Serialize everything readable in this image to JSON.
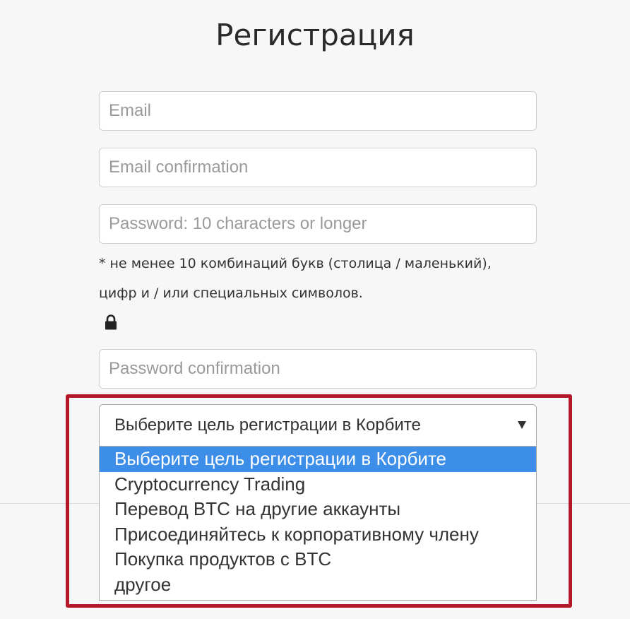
{
  "form": {
    "title": "Регистрация",
    "email": {
      "placeholder": "Email"
    },
    "email_confirmation": {
      "placeholder": "Email confirmation"
    },
    "password": {
      "placeholder": "Password: 10 characters or longer"
    },
    "password_hint": {
      "line1": "* не менее 10 комбинаций букв (столица / маленький),",
      "line2": "цифр и / или специальных символов."
    },
    "lock_icon": "lock-icon",
    "password_confirmation": {
      "placeholder": "Password confirmation"
    }
  },
  "purpose_select": {
    "selected_value": "Выберите цель регистрации в Корбите",
    "options": [
      {
        "label": "Выберите цель регистрации в Корбите",
        "highlighted": true
      },
      {
        "label": "Cryptocurrency Trading",
        "highlighted": false
      },
      {
        "label": "Перевод BTC на другие аккаунты",
        "highlighted": false
      },
      {
        "label": "Присоединяйтесь к корпоративному члену",
        "highlighted": false
      },
      {
        "label": "Покупка продуктов с BTC",
        "highlighted": false
      },
      {
        "label": "другое",
        "highlighted": false
      }
    ]
  },
  "colors": {
    "highlight_frame": "#b5172a",
    "selected_option": "#3d8ee8"
  }
}
